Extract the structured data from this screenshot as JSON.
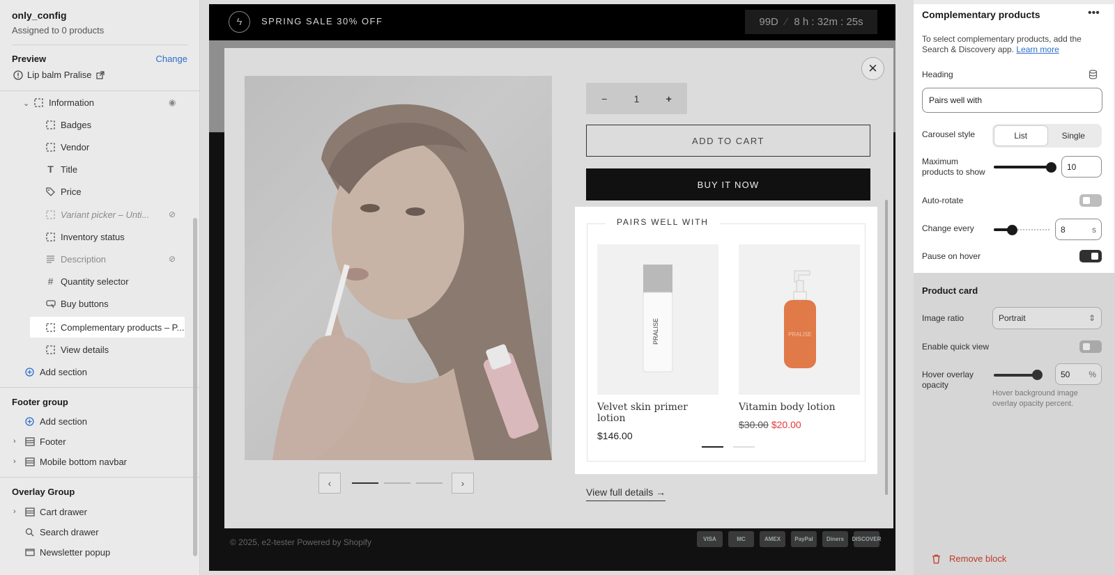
{
  "left": {
    "title": "only_config",
    "subtitle": "Assigned to 0 products",
    "preview_label": "Preview",
    "change_label": "Change",
    "product_name": "Lip balm Pralise",
    "tree": [
      {
        "label": "Information",
        "hidden": true
      },
      {
        "label": "Badges"
      },
      {
        "label": "Vendor"
      },
      {
        "label": "Title"
      },
      {
        "label": "Price"
      },
      {
        "label": "Variant picker – Unti...",
        "hidden": true
      },
      {
        "label": "Inventory status"
      },
      {
        "label": "Description",
        "hidden": true
      },
      {
        "label": "Quantity selector"
      },
      {
        "label": "Buy buttons"
      },
      {
        "label": "Complementary products – P..."
      },
      {
        "label": "View details"
      }
    ],
    "add_section": "Add section",
    "footer_group": "Footer group",
    "footer_add_section": "Add section",
    "footer_items": [
      "Footer",
      "Mobile bottom navbar"
    ],
    "overlay_group": "Overlay Group",
    "overlay_items": [
      "Cart drawer",
      "Search drawer",
      "Newsletter popup"
    ]
  },
  "preview": {
    "sale_text": "SPRING SALE 30% OFF",
    "timer_days": "99D",
    "timer_time": "8 h : 32m : 25s",
    "qty": "1",
    "add_to_cart": "ADD TO CART",
    "buy_now": "BUY IT NOW",
    "view_full": "View full details",
    "footer_text": "© 2025, e2-tester Powered by Shopify",
    "payments": [
      "VISA",
      "MC",
      "AMEX",
      "PayPal",
      "Diners",
      "DISCOVER"
    ],
    "pairs": {
      "title": "PAIRS WELL WITH",
      "products": [
        {
          "name": "Velvet skin primer lotion",
          "price": "$146.00",
          "brand": "PRALISE"
        },
        {
          "name": "Vitamin body lotion",
          "old_price": "$30.00",
          "price": "$20.00",
          "brand": "PRALISE"
        }
      ]
    }
  },
  "right": {
    "title": "Complementary products",
    "desc": "To select complementary products, add the Search & Discovery app.",
    "learn_more": "Learn more",
    "heading_label": "Heading",
    "heading_value": "Pairs well with",
    "carousel_label": "Carousel style",
    "carousel_options": [
      "List",
      "Single"
    ],
    "max_label": "Maximum products to show",
    "max_value": "10",
    "max_fraction": 1.0,
    "autorotate_label": "Auto-rotate",
    "change_every_label": "Change every",
    "change_every_value": "8",
    "change_every_unit": "s",
    "pause_label": "Pause on hover",
    "product_card_label": "Product card",
    "image_ratio_label": "Image ratio",
    "image_ratio_value": "Portrait",
    "quick_view_label": "Enable quick view",
    "hover_label": "Hover overlay opacity",
    "hover_value": "50",
    "hover_unit": "%",
    "hover_hint": "Hover background image overlay opacity percent.",
    "remove_label": "Remove block"
  }
}
